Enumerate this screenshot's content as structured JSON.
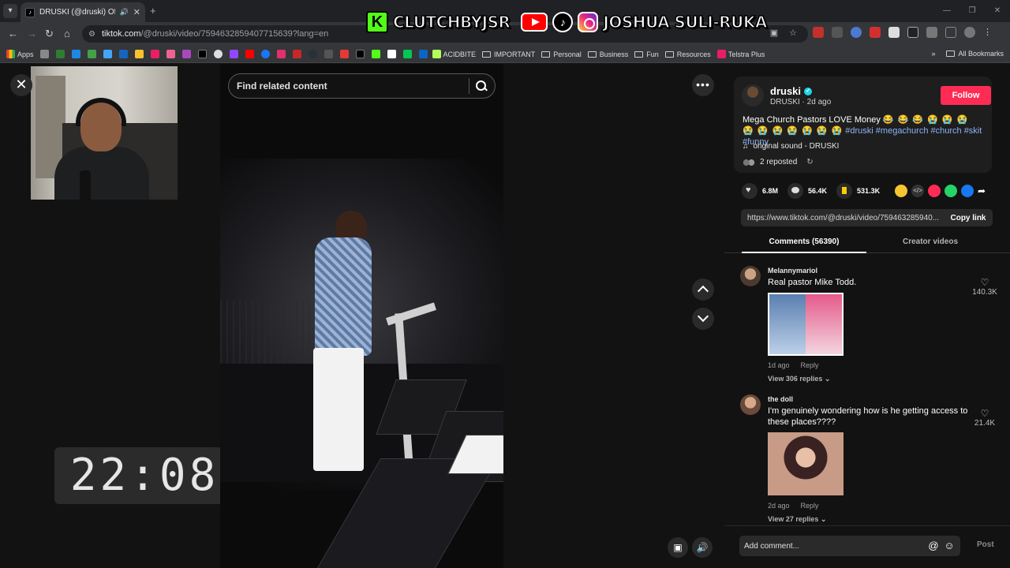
{
  "browser": {
    "tab_title": "DRUSKI (@druski) Official |",
    "url_host": "tiktok.com",
    "url_path": "/@druski/video/7594632859407715639?lang=en",
    "bookmarks": {
      "apps": "Apps",
      "items": [
        "ACIDBITE",
        "IMPORTANT",
        "Personal",
        "Business",
        "Fun",
        "Resources",
        "Telstra Plus"
      ],
      "all_bookmarks": "All Bookmarks"
    }
  },
  "overlay": {
    "kick_name": "CLUTCHBYJSR",
    "social_name": "JOSHUA SULI-RUKA",
    "clock": "22:08"
  },
  "video": {
    "search_placeholder": "Find related content"
  },
  "post": {
    "author": "druski",
    "author_sub": "DRUSKI · 2d ago",
    "follow_label": "Follow",
    "caption_text": "Mega Church Pastors LOVE Money",
    "caption_emojis": "😂 😂 😂 😭 😭 😭 😭 😭 😭 😭 😭 😭 😭",
    "caption_tags": "#druski #megachurch #church #skit #funny",
    "sound": "original sound - DRUSKI",
    "reposted": "2 reposted",
    "likes": "6.8M",
    "comments": "56.4K",
    "saves": "531.3K",
    "link": "https://www.tiktok.com/@druski/video/759463285940...",
    "copy_link_label": "Copy link"
  },
  "tabs": {
    "comments": "Comments (56390)",
    "creator_videos": "Creator videos"
  },
  "comments": [
    {
      "user": "Melannymariol",
      "text": "Real pastor Mike Todd.",
      "age": "1d ago",
      "reply": "Reply",
      "replies": "View 306 replies",
      "likes": "140.3K"
    },
    {
      "user": "the doll",
      "text": "I'm genuinely wondering how is he getting access to these places????",
      "age": "2d ago",
      "reply": "Reply",
      "replies": "View 27 replies",
      "likes": "21.4K"
    }
  ],
  "add_comment": {
    "placeholder": "Add comment...",
    "post_label": "Post"
  },
  "colors": {
    "follow": "#fe2c55",
    "hashtag": "#8ab4f8",
    "kick_green": "#53fc18",
    "save_yellow": "#facd00"
  }
}
